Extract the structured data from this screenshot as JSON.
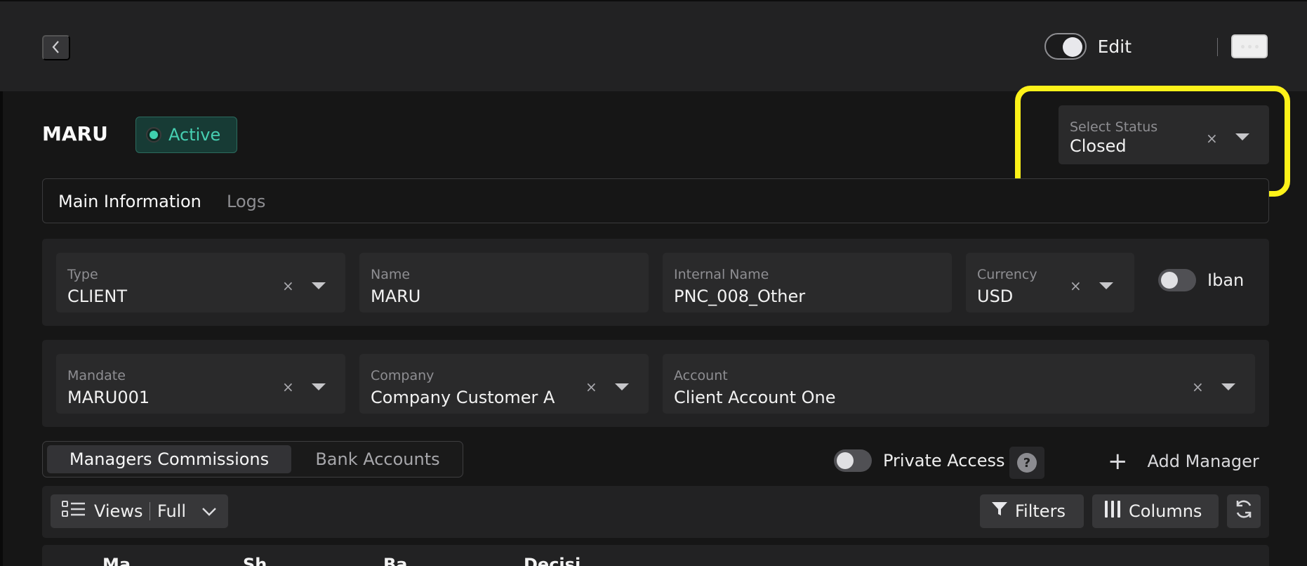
{
  "header": {
    "edit_label": "Edit"
  },
  "entity": {
    "title": "MARU",
    "status": "Active"
  },
  "select_status": {
    "label": "Select Status",
    "value": "Closed"
  },
  "tabs": [
    {
      "label": "Main Information",
      "active": true
    },
    {
      "label": "Logs",
      "active": false
    }
  ],
  "fields": {
    "type": {
      "label": "Type",
      "value": "CLIENT"
    },
    "name": {
      "label": "Name",
      "value": "MARU"
    },
    "internal_name": {
      "label": "Internal Name",
      "value": "PNC_008_Other"
    },
    "currency": {
      "label": "Currency",
      "value": "USD"
    },
    "iban_label": "Iban",
    "mandate": {
      "label": "Mandate",
      "value": "MARU001"
    },
    "company": {
      "label": "Company",
      "value": "Company Customer A"
    },
    "account": {
      "label": "Account",
      "value": "Client Account One"
    }
  },
  "section_tabs": [
    "Managers Commissions",
    "Bank Accounts"
  ],
  "controls": {
    "private_access_label": "Private Access",
    "help_symbol": "?",
    "add_manager_label": "Add Manager",
    "views_label": "Views",
    "views_mode": "Full",
    "filters_label": "Filters",
    "columns_label": "Columns"
  },
  "table_headers": [
    "Ma",
    "Sh",
    "Ba",
    "Decisi"
  ],
  "colors": {
    "active_green": "#46cfb1",
    "highlight_yellow": "#fdf219",
    "background": "#161616"
  }
}
